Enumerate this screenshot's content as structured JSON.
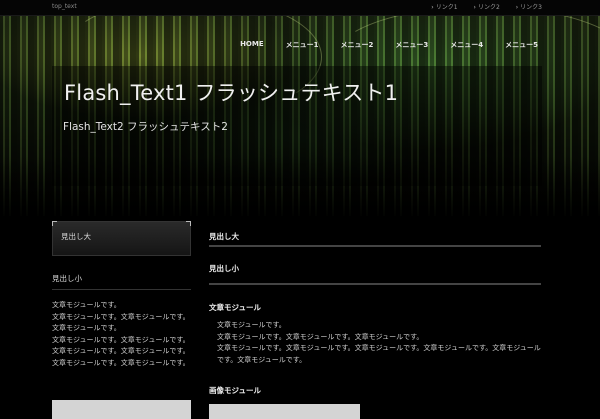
{
  "topbar": {
    "text": "top_text",
    "links": [
      "リンク1",
      "リンク2",
      "リンク3"
    ]
  },
  "nav": {
    "items": [
      "HOME",
      "メニュー1",
      "メニュー2",
      "メニュー3",
      "メニュー4",
      "メニュー5"
    ]
  },
  "header": {
    "flash_text1": "Flash_Text1 フラッシュテキスト1",
    "flash_text2": "Flash_Text2 フラッシュテキスト2"
  },
  "sidebar": {
    "heading_large": "見出し大",
    "heading_small": "見出し小",
    "text_lines": [
      "文章モジュールです。",
      "文章モジュールです。文章モジュールです。文章モジュールです。",
      "文章モジュールです。文章モジュールです。文章モジュールです。文章モジュールです。文章モジュールです。文章モジュールです。"
    ]
  },
  "main": {
    "heading_large": "見出し大",
    "heading_small": "見出し小",
    "text_module_heading": "文章モジュール",
    "text_lines": [
      "文章モジュールです。",
      "文章モジュールです。文章モジュールです。文章モジュールです。",
      "文章モジュールです。文章モジュールです。文章モジュールです。文章モジュールです。文章モジュールです。文章モジュールです。"
    ],
    "image_module_heading": "画像モジュール"
  },
  "colors": {
    "background": "#000000",
    "header_glow": "#9cc24a",
    "text": "#dddddd",
    "rule": "#444444",
    "placeholder_image": "#d4d4d4"
  }
}
